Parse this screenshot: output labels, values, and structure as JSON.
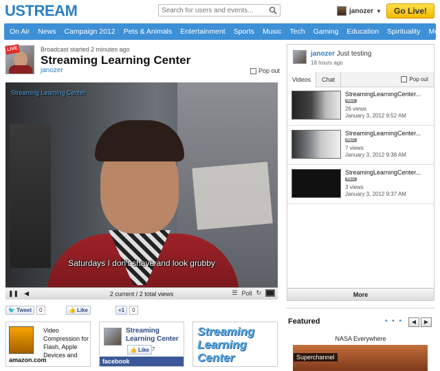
{
  "header": {
    "logo": "USTREAM",
    "search_placeholder": "Search for users and events...",
    "username": "janozer",
    "golive_label": "Go Live!"
  },
  "nav": [
    "On Air",
    "News",
    "Campaign 2012",
    "Pets & Animals",
    "Entertainment",
    "Sports",
    "Music",
    "Tech",
    "Gaming",
    "Education",
    "Spirituality",
    "More"
  ],
  "channel": {
    "live_badge": "LIVE",
    "broadcast_info": "Broadcast started 2 minutes ago",
    "title": "Streaming Learning Center",
    "owner": "janozer",
    "popout_label": "Pop out"
  },
  "video": {
    "watermark": "Streaming Learning Center",
    "subtitle": "Saturdays I don't shave and look grubby",
    "viewers": "2 current / 2 total views",
    "poll_label": "Poll"
  },
  "social": {
    "tweet_label": "Tweet",
    "tweet_count": "0",
    "like_label": "Like",
    "plus_label": "+1",
    "plus_count": "0"
  },
  "cards": {
    "amazon_text": "Video Compression for Flash, Apple Devices and",
    "amazon_brand": "amazon.com",
    "fb_name": "Streaming Learning Center",
    "fb_like": "Like",
    "fb_count": "7",
    "fb_brand": "facebook",
    "slc_logo": "Streaming Learning Center"
  },
  "right_panel": {
    "user": "janozer",
    "status": "Just testing",
    "time": "18 hours ago",
    "tabs": [
      "Videos",
      "Chat"
    ],
    "popout_label": "Pop out",
    "rec_label": "REC",
    "videos": [
      {
        "title": "StreamingLearningCenter...",
        "views": "26 views",
        "date": "January 3, 2012 9:52 AM"
      },
      {
        "title": "StreamingLearningCenter...",
        "views": "7 views",
        "date": "January 3, 2012 9:38 AM"
      },
      {
        "title": "StreamingLearningCenter...",
        "views": "3 views",
        "date": "January 3, 2012 9:37 AM"
      }
    ],
    "more_label": "More"
  },
  "featured": {
    "heading": "Featured",
    "item_title": "NASA Everywhere",
    "tag": "Superchannel"
  }
}
